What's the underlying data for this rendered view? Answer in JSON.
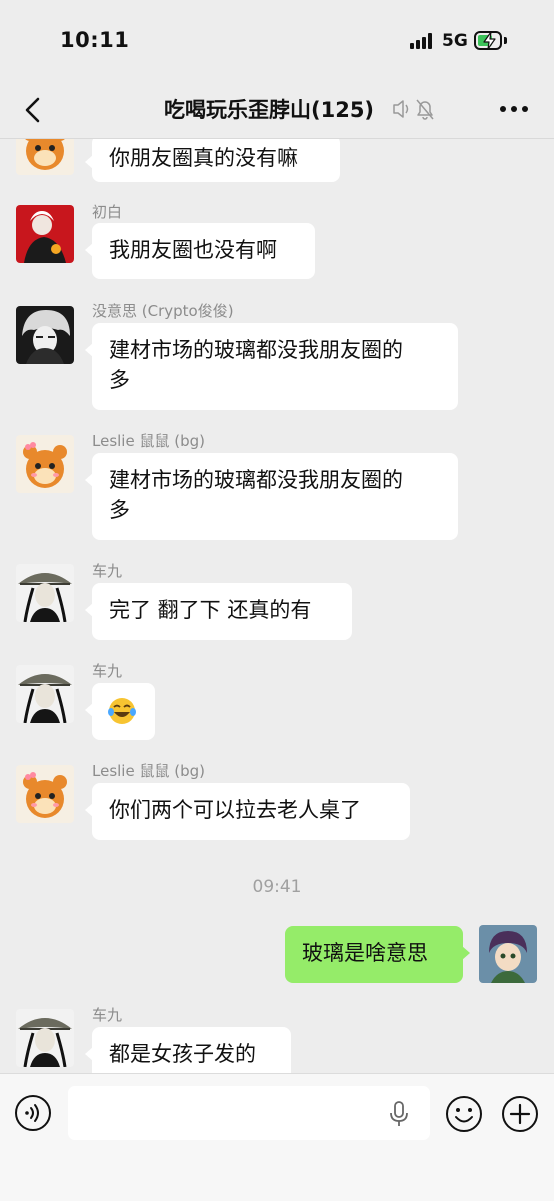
{
  "status": {
    "time": "10:11",
    "network": "5G",
    "battery_level": 0.7
  },
  "nav": {
    "title": "吃喝玩乐歪脖山(125)"
  },
  "messages": [
    {
      "sender": "",
      "text": "你朋友圈真的没有嘛"
    },
    {
      "sender": "初白",
      "text": "我朋友圈也没有啊"
    },
    {
      "sender": "没意思 (Crypto俊俊)",
      "text": "建材市场的玻璃都没我朋友圈的",
      "text2": "多"
    },
    {
      "sender": "Leslie 鼠鼠 (bg)",
      "text": "建材市场的玻璃都没我朋友圈的",
      "text2": "多"
    },
    {
      "sender": "车九",
      "text": "完了 翻了下 还真的有"
    },
    {
      "sender": "车九",
      "emoji": "laughing-crying-emoji"
    },
    {
      "sender": "Leslie 鼠鼠 (bg)",
      "text": "你们两个可以拉去老人桌了"
    },
    {
      "sender": "",
      "text": "玻璃是啥意思",
      "mine": true
    },
    {
      "sender": "车九",
      "text": "都是女孩子发的"
    }
  ],
  "time_divider": "09:41",
  "input": {
    "placeholder": ""
  },
  "colors": {
    "background": "#ededed",
    "my_bubble": "#95ec69",
    "other_bubble": "#ffffff",
    "sender_name": "#8c8c8c"
  }
}
